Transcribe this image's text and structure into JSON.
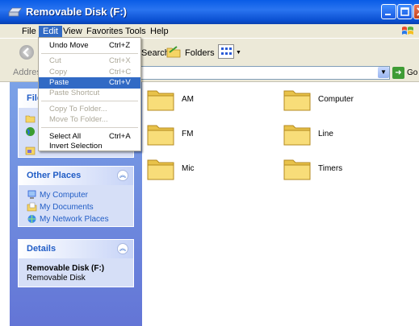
{
  "window": {
    "title": "Removable Disk (F:)"
  },
  "menubar": {
    "items": [
      "File",
      "Edit",
      "View",
      "Favorites",
      "Tools",
      "Help"
    ],
    "active": "Edit"
  },
  "toolbar": {
    "search_label": "Search",
    "folders_label": "Folders"
  },
  "addressbar": {
    "label": "Address",
    "go_label": "Go"
  },
  "edit_menu": {
    "items": [
      {
        "label": "Undo Move",
        "shortcut": "Ctrl+Z",
        "state": "enabled"
      },
      {
        "label": "Cut",
        "shortcut": "Ctrl+X",
        "state": "disabled"
      },
      {
        "label": "Copy",
        "shortcut": "Ctrl+C",
        "state": "disabled"
      },
      {
        "label": "Paste",
        "shortcut": "Ctrl+V",
        "state": "highlighted"
      },
      {
        "label": "Paste Shortcut",
        "shortcut": "",
        "state": "disabled"
      },
      {
        "label": "Copy To Folder...",
        "shortcut": "",
        "state": "disabled"
      },
      {
        "label": "Move To Folder...",
        "shortcut": "",
        "state": "disabled"
      },
      {
        "label": "Select All",
        "shortcut": "Ctrl+A",
        "state": "enabled"
      },
      {
        "label": "Invert Selection",
        "shortcut": "",
        "state": "enabled"
      }
    ]
  },
  "left_pane": {
    "file_tasks": {
      "title": "File"
    },
    "other_places": {
      "title": "Other Places",
      "links": [
        "My Computer",
        "My Documents",
        "My Network Places"
      ]
    },
    "details": {
      "title": "Details",
      "name": "Removable Disk (F:)",
      "type": "Removable Disk"
    }
  },
  "content": {
    "folders": [
      "AM",
      "Computer",
      "FM",
      "Line",
      "Mic",
      "Timers"
    ]
  },
  "colors": {
    "titlebar": "#0a5ce6",
    "menu_highlight": "#316ac5",
    "task_pane": "#7ba2e7",
    "link": "#215dc6",
    "folder": "#f5d565"
  }
}
